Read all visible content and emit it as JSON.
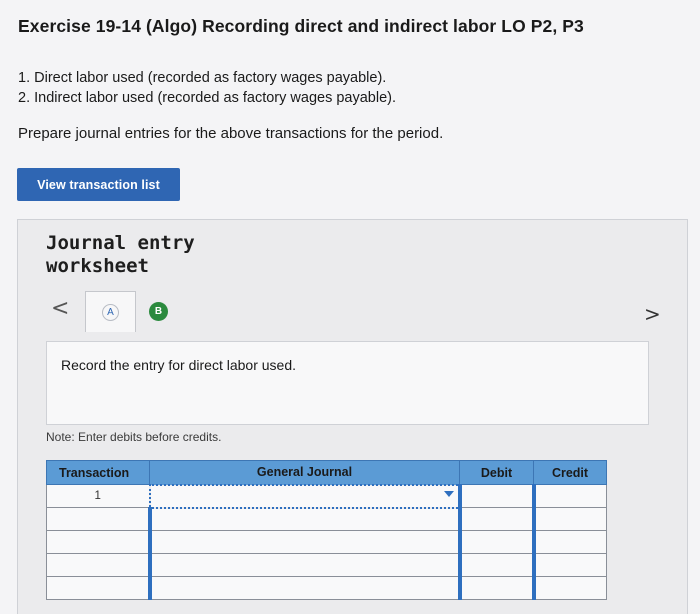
{
  "header": {
    "title": "Exercise 19-14 (Algo) Recording direct and indirect labor LO P2, P3"
  },
  "items": [
    "1. Direct labor used (recorded as factory wages payable).",
    "2. Indirect labor used (recorded as factory wages payable)."
  ],
  "prompt": "Prepare journal entries for the above transactions for the period.",
  "view_button": "View transaction list",
  "worksheet": {
    "title_line1": "Journal entry",
    "title_line2": "worksheet",
    "prev_icon": "<",
    "next_icon": ">",
    "tab_a": "A",
    "tab_b": "B",
    "instruction": "Record the entry for direct labor used.",
    "note": "Note: Enter debits before credits."
  },
  "journal": {
    "columns": [
      "Transaction",
      "General Journal",
      "Debit",
      "Credit"
    ],
    "rows": [
      {
        "transaction": "1",
        "general_journal": "",
        "debit": "",
        "credit": ""
      },
      {
        "transaction": "",
        "general_journal": "",
        "debit": "",
        "credit": ""
      },
      {
        "transaction": "",
        "general_journal": "",
        "debit": "",
        "credit": ""
      },
      {
        "transaction": "",
        "general_journal": "",
        "debit": "",
        "credit": ""
      },
      {
        "transaction": "",
        "general_journal": "",
        "debit": "",
        "credit": ""
      }
    ]
  },
  "colors": {
    "accent": "#2f66b3",
    "table_header": "#5b9bd5",
    "tab_b": "#2b8a3e"
  }
}
